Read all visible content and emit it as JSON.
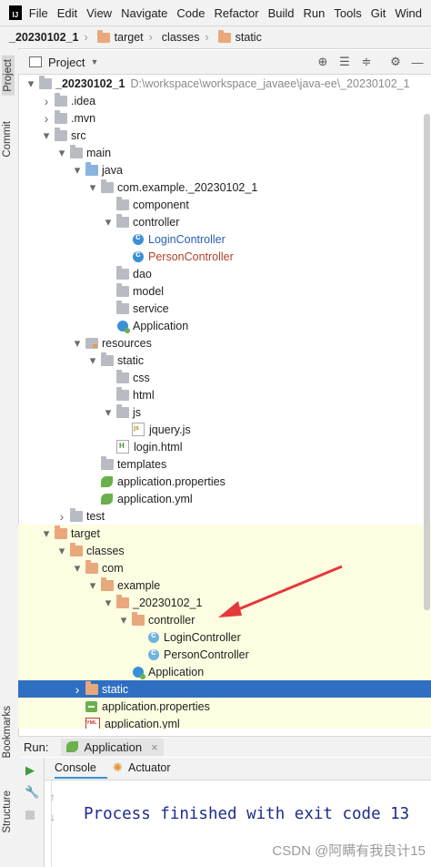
{
  "menubar": {
    "logo": "IJ",
    "items": [
      "File",
      "Edit",
      "View",
      "Navigate",
      "Code",
      "Refactor",
      "Build",
      "Run",
      "Tools",
      "Git",
      "Wind"
    ]
  },
  "breadcrumb": [
    "_20230102_1",
    "target",
    "classes",
    "static"
  ],
  "left_strip": {
    "tabs": [
      "Project",
      "Commit",
      "Bookmarks",
      "Structure"
    ]
  },
  "project_panel": {
    "title": "Project",
    "tools": [
      "target-icon",
      "collapse-icon",
      "expand-icon",
      "gear-icon",
      "minimize-icon"
    ]
  },
  "tree": [
    {
      "label": "_20230102_1",
      "extra": "D:\\workspace\\workspace_javaee\\java-ee\\_20230102_1",
      "level": 0,
      "arrow": "down",
      "icon": "folder",
      "bold": true
    },
    {
      "label": ".idea",
      "level": 1,
      "arrow": "right",
      "icon": "folder"
    },
    {
      "label": ".mvn",
      "level": 1,
      "arrow": "right",
      "icon": "folder"
    },
    {
      "label": "src",
      "level": 1,
      "arrow": "down",
      "icon": "folder"
    },
    {
      "label": "main",
      "level": 2,
      "arrow": "down",
      "icon": "folder"
    },
    {
      "label": "java",
      "level": 3,
      "arrow": "down",
      "icon": "folder-blue"
    },
    {
      "label": "com.example._20230102_1",
      "level": 4,
      "arrow": "down",
      "icon": "folder"
    },
    {
      "label": "component",
      "level": 5,
      "arrow": "none",
      "icon": "folder"
    },
    {
      "label": "controller",
      "level": 5,
      "arrow": "down",
      "icon": "folder"
    },
    {
      "label": "LoginController",
      "level": 6,
      "arrow": "none",
      "icon": "class",
      "color": "blue"
    },
    {
      "label": "PersonController",
      "level": 6,
      "arrow": "none",
      "icon": "class",
      "color": "red"
    },
    {
      "label": "dao",
      "level": 5,
      "arrow": "none",
      "icon": "folder"
    },
    {
      "label": "model",
      "level": 5,
      "arrow": "none",
      "icon": "folder"
    },
    {
      "label": "service",
      "level": 5,
      "arrow": "none",
      "icon": "folder"
    },
    {
      "label": "Application",
      "level": 5,
      "arrow": "none",
      "icon": "app"
    },
    {
      "label": "resources",
      "level": 3,
      "arrow": "down",
      "icon": "folder-res"
    },
    {
      "label": "static",
      "level": 4,
      "arrow": "down",
      "icon": "folder"
    },
    {
      "label": "css",
      "level": 5,
      "arrow": "none",
      "icon": "folder"
    },
    {
      "label": "html",
      "level": 5,
      "arrow": "none",
      "icon": "folder"
    },
    {
      "label": "js",
      "level": 5,
      "arrow": "down",
      "icon": "folder"
    },
    {
      "label": "jquery.js",
      "level": 6,
      "arrow": "none",
      "icon": "js"
    },
    {
      "label": "login.html",
      "level": 5,
      "arrow": "none",
      "icon": "html"
    },
    {
      "label": "templates",
      "level": 4,
      "arrow": "none",
      "icon": "folder"
    },
    {
      "label": "application.properties",
      "level": 4,
      "arrow": "none",
      "icon": "leaf"
    },
    {
      "label": "application.yml",
      "level": 4,
      "arrow": "none",
      "icon": "leaf"
    },
    {
      "label": "test",
      "level": 2,
      "arrow": "right",
      "icon": "folder"
    },
    {
      "label": "target",
      "level": 1,
      "arrow": "down",
      "icon": "folder-orange",
      "yellow": true
    },
    {
      "label": "classes",
      "level": 2,
      "arrow": "down",
      "icon": "folder-orange",
      "yellow": true
    },
    {
      "label": "com",
      "level": 3,
      "arrow": "down",
      "icon": "folder-orange",
      "yellow": true
    },
    {
      "label": "example",
      "level": 4,
      "arrow": "down",
      "icon": "folder-orange",
      "yellow": true
    },
    {
      "label": "_20230102_1",
      "level": 5,
      "arrow": "down",
      "icon": "folder-orange",
      "yellow": true
    },
    {
      "label": "controller",
      "level": 6,
      "arrow": "down",
      "icon": "folder-orange",
      "yellow": true
    },
    {
      "label": "LoginController",
      "level": 7,
      "arrow": "none",
      "icon": "class-t",
      "yellow": true
    },
    {
      "label": "PersonController",
      "level": 7,
      "arrow": "none",
      "icon": "class-t",
      "yellow": true
    },
    {
      "label": "Application",
      "level": 6,
      "arrow": "none",
      "icon": "app",
      "yellow": true
    },
    {
      "label": "static",
      "level": 3,
      "arrow": "right",
      "icon": "folder-orange",
      "selected": true
    },
    {
      "label": "application.properties",
      "level": 3,
      "arrow": "none",
      "icon": "props",
      "yellow": true
    },
    {
      "label": "application.yml",
      "level": 3,
      "arrow": "none",
      "icon": "yml",
      "yellow": true
    }
  ],
  "run_panel": {
    "label": "Run:",
    "config": "Application",
    "tabs": [
      "Console",
      "Actuator"
    ],
    "output": "Process finished with exit code 13"
  },
  "watermark": "CSDN @阿瞒有我良计15",
  "colors": {
    "selection": "#2f6fc2",
    "excluded_bg": "#fdfde2",
    "arrow": "#e5383b"
  }
}
